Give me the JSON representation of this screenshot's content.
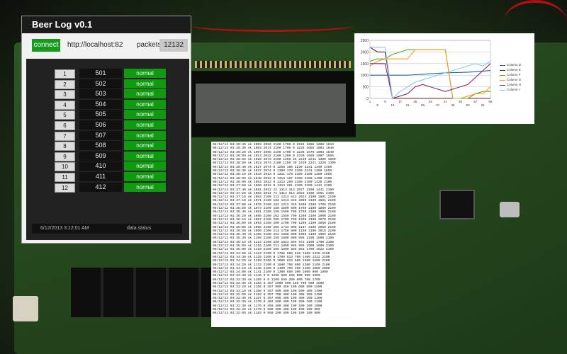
{
  "app": {
    "title": "Beer Log v0.1",
    "connect_label": "connect",
    "url": "http://localhost:82",
    "packets_label": "packets",
    "packets_value": "12132",
    "rows": [
      {
        "num": "1",
        "value": "501",
        "status": "normal"
      },
      {
        "num": "2",
        "value": "502",
        "status": "normal"
      },
      {
        "num": "3",
        "value": "503",
        "status": "normal"
      },
      {
        "num": "4",
        "value": "504",
        "status": "normal"
      },
      {
        "num": "5",
        "value": "505",
        "status": "normal"
      },
      {
        "num": "6",
        "value": "506",
        "status": "normal"
      },
      {
        "num": "7",
        "value": "507",
        "status": "normal"
      },
      {
        "num": "8",
        "value": "508",
        "status": "normal"
      },
      {
        "num": "9",
        "value": "509",
        "status": "normal"
      },
      {
        "num": "10",
        "value": "410",
        "status": "normal"
      },
      {
        "num": "11",
        "value": "411",
        "status": "normal"
      },
      {
        "num": "12",
        "value": "412",
        "status": "normal"
      }
    ],
    "timestamp": "6/12/2013 3:12:01 AM",
    "status_text": "data.status",
    "colors": {
      "accent": "#159a1c",
      "title_bg": "#1b1b1b"
    }
  },
  "chart_data": {
    "type": "line",
    "ylim": [
      0,
      2500
    ],
    "yticks": [
      "2500",
      "2000",
      "1500",
      "1000",
      "500",
      "0"
    ],
    "xticks": [
      "1",
      "5",
      "9",
      "13",
      "17",
      "21",
      "25",
      "29",
      "33",
      "37",
      "41",
      "45",
      "49",
      "53",
      "57",
      "61",
      "65"
    ],
    "series": [
      {
        "name": "Column D",
        "color": "#2060b0",
        "values": [
          1000,
          1000,
          1000,
          1000,
          1000,
          1000,
          1020,
          1040,
          1060,
          1080,
          1100,
          1110,
          1120,
          1130,
          1150,
          1170,
          1200
        ]
      },
      {
        "name": "Column E",
        "color": "#6b1e1e",
        "values": [
          2200,
          2000,
          2000,
          0,
          0,
          0,
          0,
          0,
          0,
          0,
          0,
          0,
          0,
          0,
          0,
          0,
          0
        ]
      },
      {
        "name": "Column F",
        "color": "#55aa22",
        "values": [
          1600,
          1700,
          1700,
          1900,
          2000,
          2100,
          2100,
          2100,
          2100,
          2100,
          2100,
          0,
          0,
          0,
          200,
          300,
          300
        ]
      },
      {
        "name": "Column G",
        "color": "#ff9a20",
        "values": [
          1400,
          1600,
          1700,
          1700,
          1700,
          1700,
          2100,
          2100,
          2100,
          2100,
          2100,
          0,
          0,
          100,
          200,
          200,
          500
        ]
      },
      {
        "name": "Column H",
        "color": "#7a2a7a",
        "values": [
          1500,
          1500,
          1500,
          0,
          100,
          200,
          500,
          600,
          500,
          400,
          300,
          400,
          500,
          600,
          900,
          1200,
          1500
        ]
      },
      {
        "name": "Column I",
        "color": "#88c8ee",
        "values": [
          2200,
          2200,
          2200,
          0,
          300,
          500,
          700,
          800,
          900,
          1000,
          1100,
          1200,
          1300,
          1400,
          1500,
          1400,
          1600
        ]
      }
    ]
  },
  "log_lines": [
    "06/12/13 03:39:39 ok 1003 2026 2100 1700 0 2226 1666 1008 1633",
    "06/12/13 03:39:30 ok 1003 2074 2100 1700 0 2226 1666 1003 1640",
    "06/12/13 03:39:20 ok 1007 2006 2100 1700 0 2230 1670 1003 1649",
    "06/12/13 03:39:09 ok 1013 2022 2100 1260 0 2230 1680 1007 1656",
    "06/12/13 03:38:59 ok 1020 2073 2100 1258 25 2230 2241 1300 1000",
    "06/12/13 03:38:50 ok 1023 2074 2100 1258 30 2230 2241 1320 1309",
    "06/12/13 03:38:40 ok 1027 2074 0 1258 166 2230 2241 1340 1459",
    "06/12/13 03:38:30 ok 1037 2074 0 1300 170 2100 2241 1360 1659",
    "06/12/13 03:38:19 ok 1043 2013 0 1311 170 2100 2100 1380 1659",
    "06/12/13 03:38:09 ok 1048 2012 0 1313 167 2100 2100 1400 2100",
    "06/12/13 03:38:00 ok 1053 2012 0 1313 250 2100 2100 1420 2100",
    "06/12/13 03:37:50 ok 1060 2012 0 1313 281 2100 2100 1431 2100",
    "06/12/13 03:37:40 ok 1061 2012 22 1313 313 2027 2100 1441 2100",
    "06/12/13 03:37:29 ok 1063 2012 71 1313 513 2023 2100 1591 2100",
    "06/12/13 03:37:19 ok 1063 2100 113 1313 513 2023 2100 1691 2100",
    "06/12/13 03:37:10 ok 1071 2100 162 1313 345 2000 2100 1681 2100",
    "06/12/13 03:37:00 ok 1070 2100 162 1313 345 1800 2100 1700 2100",
    "06/12/13 03:36:50 ok 1073 2100 150 1500 600 1700 2100 1800 2100",
    "06/12/13 03:36:40 ok 1081 2100 150 1500 700 1700 2100 1900 2100",
    "06/12/13 03:36:29 ok 1085 2100 162 1550 700 1200 2100 2000 2100",
    "06/12/13 03:36:19 ok 1087 2100 205 1700 700 1200 2100 2070 2100",
    "06/12/13 03:36:09 ok 1093 2100 200 1700 700 1200 2100 2050 2100",
    "06/12/13 03:36:00 ok 1098 2100 205 1733 800 1107 2100 2050 2100",
    "06/12/13 03:35:50 ok 1099 2100 213 1750 800 1100 2100 2015 2100",
    "06/12/13 03:35:40 ok 1105 2100 253 1800 800 1000 2100 1909 2100",
    "06/12/13 03:35:30 ok 1108 2100 255 1800 800 996 2100 1800 2100",
    "06/12/13 03:35:19 ok 1113 2100 250 1823 885 973 2100 1700 2100",
    "06/12/13 03:35:09 ok 1116 2100 211 1800 885 905 1900 1600 2100",
    "06/12/13 03:35:00 ok 1119 2100 205 1800 885 883 1700 1522 2100",
    "06/12/13 03:34:50 ok 1123 2100 0 1785 885 810 1500 1425 2100",
    "06/12/13 03:34:39 ok 1125 2100 0 1700 813 700 1400 1322 2100",
    "06/12/13 03:34:29 ok 1128 2100 0 1600 813 600 1300 1200 2100",
    "06/12/13 03:34:20 ok 1133 2100 0 1500 750 500 1200 1100 2100",
    "06/12/13 03:34:10 ok 1136 2100 0 1400 700 400 1100 1000 2000",
    "06/12/13 03:34:00 ok 1141 2100 0 1300 650 300 1000 900 1900",
    "06/12/13 03:33:49 ok 1146 0 0 1200 600 250 900 800 1800",
    "06/12/13 03:33:39 ok 1150 0 0 1100 550 200 800 700 1700",
    "06/12/13 03:33:30 ok 1153 0 357 1000 500 150 700 600 1600",
    "06/12/13 03:33:20 ok 1156 0 357 900 450 100 600 500 1500",
    "06/12/13 03:33:10 ok 1160 0 357 800 400 100 500 400 1400",
    "06/12/13 03:32:59 ok 1163 0 357 700 400 100 400 300 1300",
    "06/12/13 03:32:49 ok 1167 0 357 600 400 100 300 200 1200",
    "06/12/13 03:32:39 ok 1170 0 402 500 400 100 200 100 1100",
    "06/12/13 03:32:30 ok 1175 0 450 400 400 100 100 100 1000",
    "06/12/13 03:32:20 ok 1179 0 500 300 400 100 100 100 900",
    "06/12/13 03:32:09 ok 1183 0 550 200 400 100 100 100 800"
  ]
}
